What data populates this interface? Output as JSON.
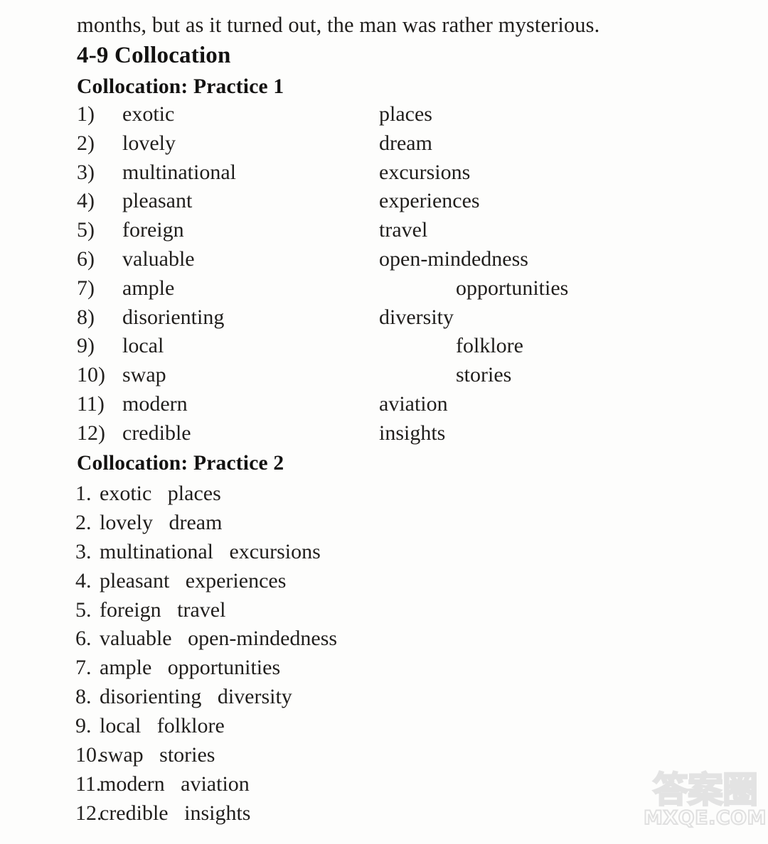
{
  "page": {
    "background_color": "#fdfdfc",
    "text_color": "#201e1c",
    "carryover_line": "months, but as it turned out, the man was rather mysterious."
  },
  "section": {
    "heading": "4-9 Collocation"
  },
  "practice1": {
    "heading": "Collocation: Practice 1",
    "items": [
      {
        "number": "1)",
        "word": "exotic",
        "pair": "places",
        "indented": false
      },
      {
        "number": "2)",
        "word": "lovely",
        "pair": "dream",
        "indented": false
      },
      {
        "number": "3)",
        "word": "multinational",
        "pair": "excursions",
        "indented": false
      },
      {
        "number": "4)",
        "word": "pleasant",
        "pair": "experiences",
        "indented": false
      },
      {
        "number": "5)",
        "word": "foreign",
        "pair": "travel",
        "indented": false
      },
      {
        "number": "6)",
        "word": "valuable",
        "pair": "open-mindedness",
        "indented": false
      },
      {
        "number": "7)",
        "word": "ample",
        "pair": "opportunities",
        "indented": true
      },
      {
        "number": "8)",
        "word": "disorienting",
        "pair": "diversity",
        "indented": false
      },
      {
        "number": "9)",
        "word": "local",
        "pair": "folklore",
        "indented": true
      },
      {
        "number": "10)",
        "word": "swap",
        "pair": "stories",
        "indented": true
      },
      {
        "number": "11)",
        "word": "modern",
        "pair": "aviation",
        "indented": false
      },
      {
        "number": "12)",
        "word": "credible",
        "pair": "insights",
        "indented": false
      }
    ]
  },
  "practice2": {
    "heading": "Collocation: Practice 2",
    "items": [
      {
        "number": "1.",
        "text": "exotic   places"
      },
      {
        "number": "2.",
        "text": "lovely   dream"
      },
      {
        "number": "3.",
        "text": "multinational   excursions"
      },
      {
        "number": "4.",
        "text": "pleasant   experiences"
      },
      {
        "number": "5.",
        "text": "foreign   travel"
      },
      {
        "number": "6.",
        "text": "valuable   open-mindedness"
      },
      {
        "number": "7.",
        "text": "ample   opportunities"
      },
      {
        "number": "8.",
        "text": "disorienting   diversity"
      },
      {
        "number": "9.",
        "text": "local   folklore"
      },
      {
        "number": "10.",
        "text": "swap   stories"
      },
      {
        "number": "11.",
        "text": "modern   aviation"
      },
      {
        "number": "12.",
        "text": "credible   insights"
      }
    ]
  },
  "watermark": {
    "chinese": "答案圈",
    "domain": "MXQE.COM",
    "color": "#e3e3e3"
  }
}
